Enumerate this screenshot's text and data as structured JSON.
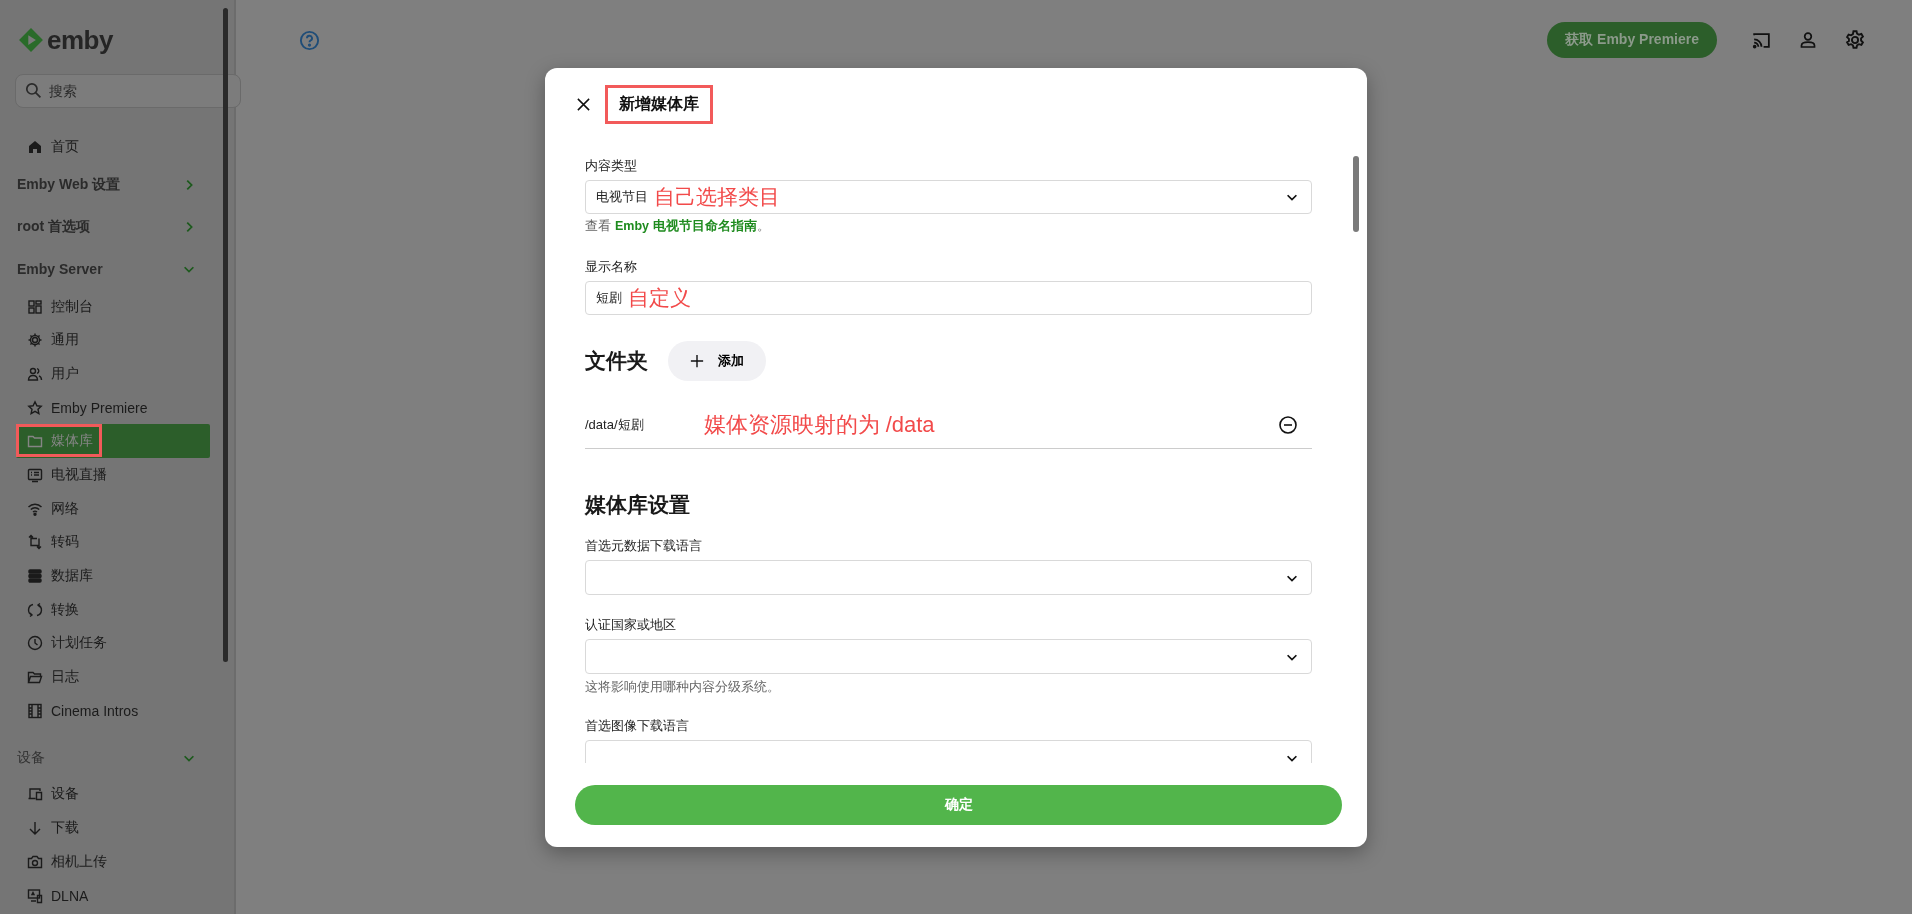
{
  "sidebar": {
    "logo": "emby",
    "search": {
      "placeholder": "搜索"
    },
    "home": {
      "label": "首页",
      "selected": false
    },
    "sections": [
      {
        "title": "Emby Web 设置",
        "kind": "heading",
        "expanded": false
      },
      {
        "title": "root 首选项",
        "kind": "heading",
        "expanded": false
      },
      {
        "title": "Emby Server",
        "kind": "heading",
        "expanded": true,
        "items": [
          {
            "label": "控制台",
            "selected": false,
            "annotated": false
          },
          {
            "label": "通用",
            "selected": false,
            "annotated": false
          },
          {
            "label": "用户",
            "selected": false,
            "annotated": false
          },
          {
            "label": "Emby Premiere",
            "selected": false,
            "annotated": false
          },
          {
            "label": "媒体库",
            "selected": true,
            "annotated": true
          },
          {
            "label": "电视直播",
            "selected": false,
            "annotated": false
          },
          {
            "label": "网络",
            "selected": false,
            "annotated": false
          },
          {
            "label": "转码",
            "selected": false,
            "annotated": false
          },
          {
            "label": "数据库",
            "selected": false,
            "annotated": false
          },
          {
            "label": "转换",
            "selected": false,
            "annotated": false
          },
          {
            "label": "计划任务",
            "selected": false,
            "annotated": false
          },
          {
            "label": "日志",
            "selected": false,
            "annotated": false
          },
          {
            "label": "Cinema Intros",
            "selected": false,
            "annotated": false
          }
        ]
      },
      {
        "title": "设备",
        "kind": "subheading",
        "expanded": true,
        "items": [
          {
            "label": "设备",
            "selected": false,
            "annotated": false
          },
          {
            "label": "下载",
            "selected": false,
            "annotated": false
          },
          {
            "label": "相机上传",
            "selected": false,
            "annotated": false
          },
          {
            "label": "DLNA",
            "selected": false,
            "annotated": false
          }
        ]
      }
    ]
  },
  "header": {
    "premiere_button": "获取 Emby Premiere"
  },
  "dialog": {
    "title": "新增媒体库",
    "title_annotated": true,
    "content_type": {
      "label": "内容类型",
      "value": "电视节目",
      "annotation": "自己选择类目",
      "help": {
        "text": "查看",
        "link": "Emby 电视节目命名指南",
        "after": "。"
      }
    },
    "display_name": {
      "label": "显示名称",
      "value": "短剧",
      "annotation": "自定义"
    },
    "folders": {
      "heading": "文件夹",
      "add_button": "添加",
      "rows": [
        {
          "path": "/data/短剧",
          "annotation": "媒体资源映射的为 /data"
        }
      ]
    },
    "settings": {
      "heading": "媒体库设置",
      "fields": [
        {
          "label": "首选元数据下载语言"
        },
        {
          "label": "认证国家或地区",
          "help": "这将影响使用哪种内容分级系统。"
        },
        {
          "label": "首选图像下载语言"
        }
      ]
    },
    "confirm_button": "确定"
  }
}
